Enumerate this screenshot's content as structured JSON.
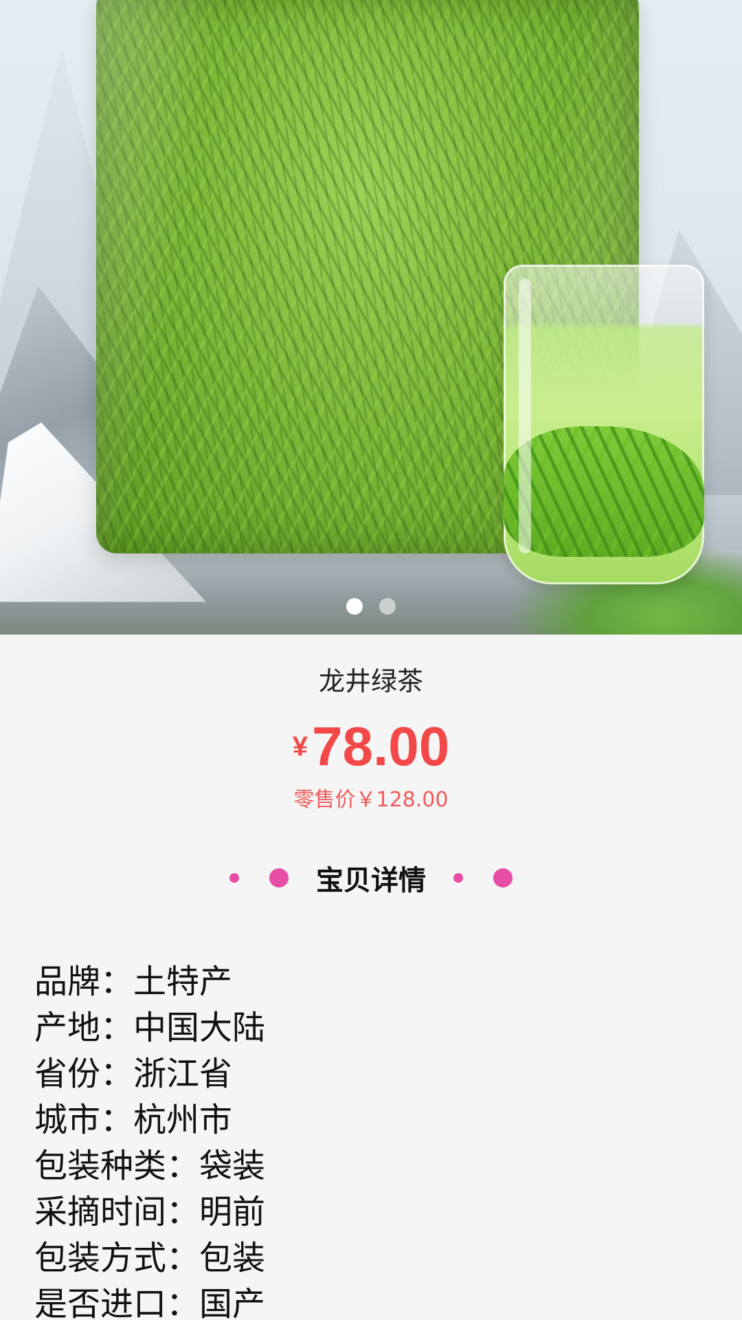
{
  "carousel": {
    "image_description": "Longjing green tea leaves in a clear bag beside a glass of brewed tea",
    "total": 2,
    "active_index": 0
  },
  "product": {
    "title": "龙井绿茶",
    "price_symbol": "¥",
    "price": "78.00",
    "retail_price": "零售价￥128.00"
  },
  "details_section": {
    "title": "宝贝详情",
    "accent_color": "#e84da6"
  },
  "attributes": [
    {
      "label": "品牌：",
      "value": "土特产"
    },
    {
      "label": "产地：",
      "value": "中国大陆"
    },
    {
      "label": "省份：",
      "value": "浙江省"
    },
    {
      "label": "城市：",
      "value": "杭州市"
    },
    {
      "label": "包装种类：",
      "value": "袋装"
    },
    {
      "label": "采摘时间：",
      "value": "明前"
    },
    {
      "label": "包装方式：",
      "value": "包装"
    },
    {
      "label": "是否进口：",
      "value": "国产"
    }
  ],
  "colors": {
    "price": "#f24848",
    "background": "#f5f5f5"
  }
}
